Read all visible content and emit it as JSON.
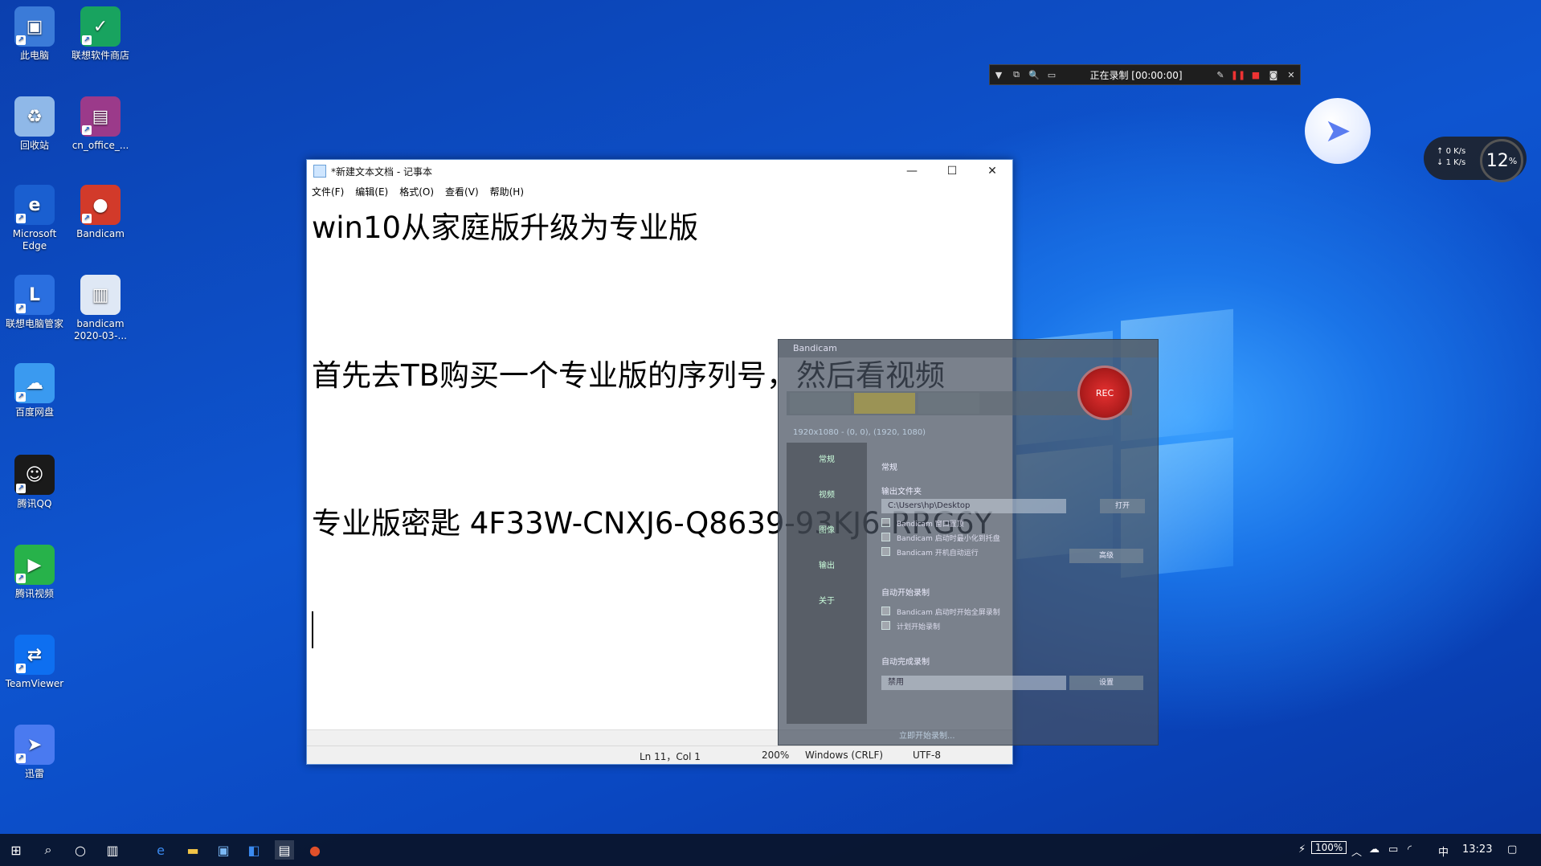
{
  "desktop": {
    "icons": [
      {
        "label": "此电脑",
        "icon": "computer-icon",
        "color": "#3b7bd8"
      },
      {
        "label": "联想软件商店",
        "icon": "store-icon",
        "color": "#18a35f"
      },
      {
        "label": "回收站",
        "icon": "recycle-bin-icon",
        "color": "#8fb8e8"
      },
      {
        "label": "cn_office_...",
        "icon": "winrar-icon",
        "color": "#9b3a8a"
      },
      {
        "label": "Microsoft Edge",
        "icon": "edge-icon",
        "color": "#1a5fd0"
      },
      {
        "label": "Bandicam",
        "icon": "bandicam-icon",
        "color": "#d23a2a"
      },
      {
        "label": "联想电脑管家",
        "icon": "lenovo-manager-icon",
        "color": "#2a6fe0"
      },
      {
        "label": "bandicam 2020-03-...",
        "icon": "file-icon",
        "color": "#dfe8f5"
      },
      {
        "label": "百度网盘",
        "icon": "baidu-netdisk-icon",
        "color": "#3a9af0"
      },
      {
        "label": "腾讯QQ",
        "icon": "qq-icon",
        "color": "#1a1a1a"
      },
      {
        "label": "腾讯视频",
        "icon": "tencent-video-icon",
        "color": "#27b24a"
      },
      {
        "label": "TeamViewer",
        "icon": "teamviewer-icon",
        "color": "#0e6ff0"
      },
      {
        "label": "迅雷",
        "icon": "xunlei-icon",
        "color": "#4a7af0"
      }
    ]
  },
  "recorder_toolbar": {
    "status": "正在录制 [00:00:00]"
  },
  "notepad": {
    "title": "*新建文本文档 - 记事本",
    "menu": [
      "文件(F)",
      "编辑(E)",
      "格式(O)",
      "查看(V)",
      "帮助(H)"
    ],
    "lines": [
      "win10从家庭版升级为专业版",
      "首先去TB购买一个专业版的序列号，然后看视频",
      "专业版密匙 4F33W-CNXJ6-Q8639-93KJ6-RRG6Y"
    ],
    "status": {
      "position": "Ln 11，Col 1",
      "zoom": "200%",
      "line_ending": "Windows (CRLF)",
      "encoding": "UTF-8"
    }
  },
  "bandicam": {
    "title": "Bandicam",
    "rec_label": "REC",
    "resolution": "1920x1080 - (0, 0), (1920, 1080)",
    "sidebar": [
      "常规",
      "视频",
      "图像",
      "输出",
      "关于"
    ],
    "section_general": "常规",
    "section_output_label": "输出文件夹",
    "output_path": "C:\\Users\\hp\\Desktop",
    "open_button": "打开",
    "options": [
      "Bandicam 窗口置顶",
      "Bandicam 启动时最小化到托盘",
      "Bandicam 开机自动运行"
    ],
    "advanced_button": "高级",
    "section_auto_start": "自动开始录制",
    "auto_start_options": [
      "Bandicam 启动时开始全屏录制",
      "计划开始录制"
    ],
    "section_auto_stop": "自动完成录制",
    "auto_stop_value": "禁用",
    "settings_button": "设置",
    "footer": "立即开始录制..."
  },
  "speed_widget": {
    "up": "0 K/s",
    "down": "1 K/s",
    "percent": "12",
    "percent_unit": "%"
  },
  "taskbar": {
    "battery": "100%",
    "ime": "中",
    "time": "13:23"
  }
}
